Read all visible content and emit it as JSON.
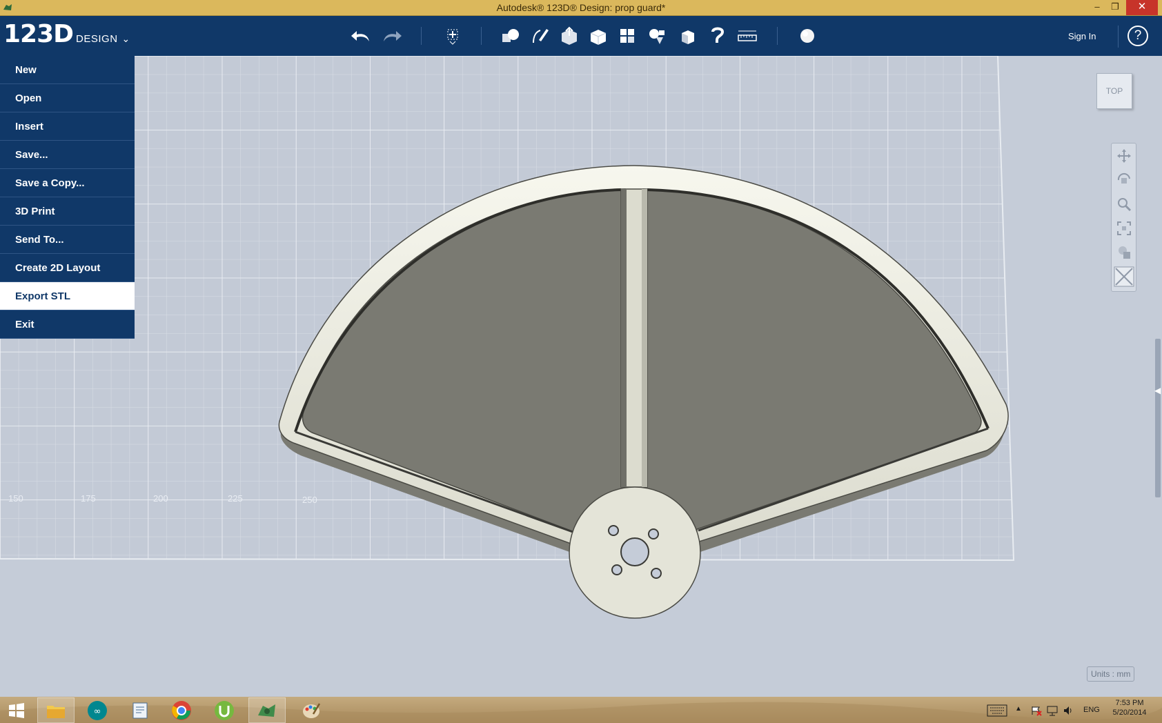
{
  "window": {
    "title": "Autodesk® 123D® Design: prop guard*",
    "minimize": "–",
    "restore": "❐",
    "close": "✕"
  },
  "logo": {
    "main": "123D",
    "sub": "DESIGN",
    "chevron": "⌄"
  },
  "toolbar": {
    "icons": [
      "undo-icon",
      "redo-icon",
      "transform-icon",
      "primitives-icon",
      "sketch-icon",
      "construct-icon",
      "modify-icon",
      "pattern-icon",
      "grouping-icon",
      "combine-icon",
      "snap-icon",
      "measure-icon",
      "material-icon"
    ],
    "signin": "Sign In",
    "help": "?"
  },
  "menu": {
    "items": [
      "New",
      "Open",
      "Insert",
      "Save...",
      "Save a Copy...",
      "3D Print",
      "Send To...",
      "Create 2D Layout",
      "Export STL",
      "Exit"
    ],
    "active": "Export STL"
  },
  "viewport": {
    "viewcube_label": "TOP",
    "grid_labels": [
      "150",
      "175",
      "200",
      "225",
      "250"
    ],
    "nav_icons": [
      "pan-icon",
      "orbit-icon",
      "zoom-icon",
      "fit-icon",
      "view-style-icon",
      "material-toggle-icon"
    ],
    "units": "Units : mm"
  },
  "taskbar": {
    "apps": [
      "windows-start-icon",
      "file-explorer-icon",
      "arduino-icon",
      "notepad-icon",
      "chrome-icon",
      "utorrent-icon",
      "123d-design-icon",
      "paint-icon"
    ],
    "lang": "ENG",
    "time": "7:53 PM",
    "date": "5/20/2014"
  },
  "colors": {
    "toolbar": "#103868",
    "titlebar": "#dbb85c",
    "grid_bg": "#c5ccd8",
    "model": "#e8e8dc"
  }
}
